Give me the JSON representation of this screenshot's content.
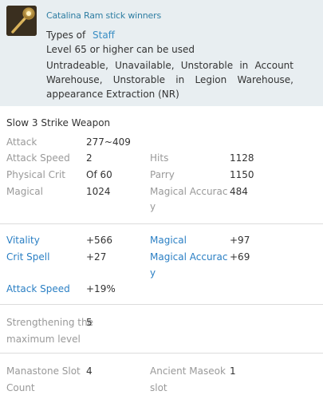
{
  "header": {
    "item_name": "Catalina Ram stick winners",
    "types_label": "Types of",
    "types_value": "Staff",
    "level_req": "Level 65 or higher can be used",
    "restrictions": "Untradeable, Unavailable, Unstorable in Account Warehouse, Unstorable in Legion Warehouse, appearance Extraction (NR)"
  },
  "weapon_type": "Slow 3 Strike Weapon",
  "base_stats": {
    "attack": {
      "label": "Attack",
      "value": "277~409"
    },
    "attack_speed": {
      "label": "Attack Speed",
      "value": "2"
    },
    "hits": {
      "label": "Hits",
      "value": "1128"
    },
    "physical_crit": {
      "label": "Physical Crit",
      "value": "Of 60"
    },
    "parry": {
      "label": "Parry",
      "value": "1150"
    },
    "magical": {
      "label": "Magical",
      "value": "1024"
    },
    "magical_accuracy": {
      "label_line1": "Magical Accurac",
      "label_line2": "y",
      "value": "484"
    }
  },
  "bonus_stats": {
    "vitality": {
      "label": "Vitality",
      "value": "+566"
    },
    "magical": {
      "label": "Magical",
      "value": "+97"
    },
    "crit_spell": {
      "label": "Crit Spell",
      "value": "+27"
    },
    "magical_accuracy": {
      "label_line1": "Magical Accurac",
      "label_line2": "y",
      "value": "+69"
    },
    "attack_speed": {
      "label": "Attack Speed",
      "value": "+19%"
    }
  },
  "enchant": {
    "label_line1": "Strengthening the",
    "label_line2": "maximum level",
    "value": "5"
  },
  "slots": {
    "manastone": {
      "label_line1": "Manastone Slot",
      "label_line2": "Count",
      "value": "4"
    },
    "ancient": {
      "label_line1": "Ancient Maseok",
      "label_line2": "slot",
      "value": "1"
    }
  },
  "icons": {
    "item": "staff-icon"
  },
  "colors": {
    "header_bg": "#e8eef1",
    "item_name": "#2f7ea3",
    "bonus_blue": "#2a7fc4",
    "label_gray": "#999999"
  }
}
